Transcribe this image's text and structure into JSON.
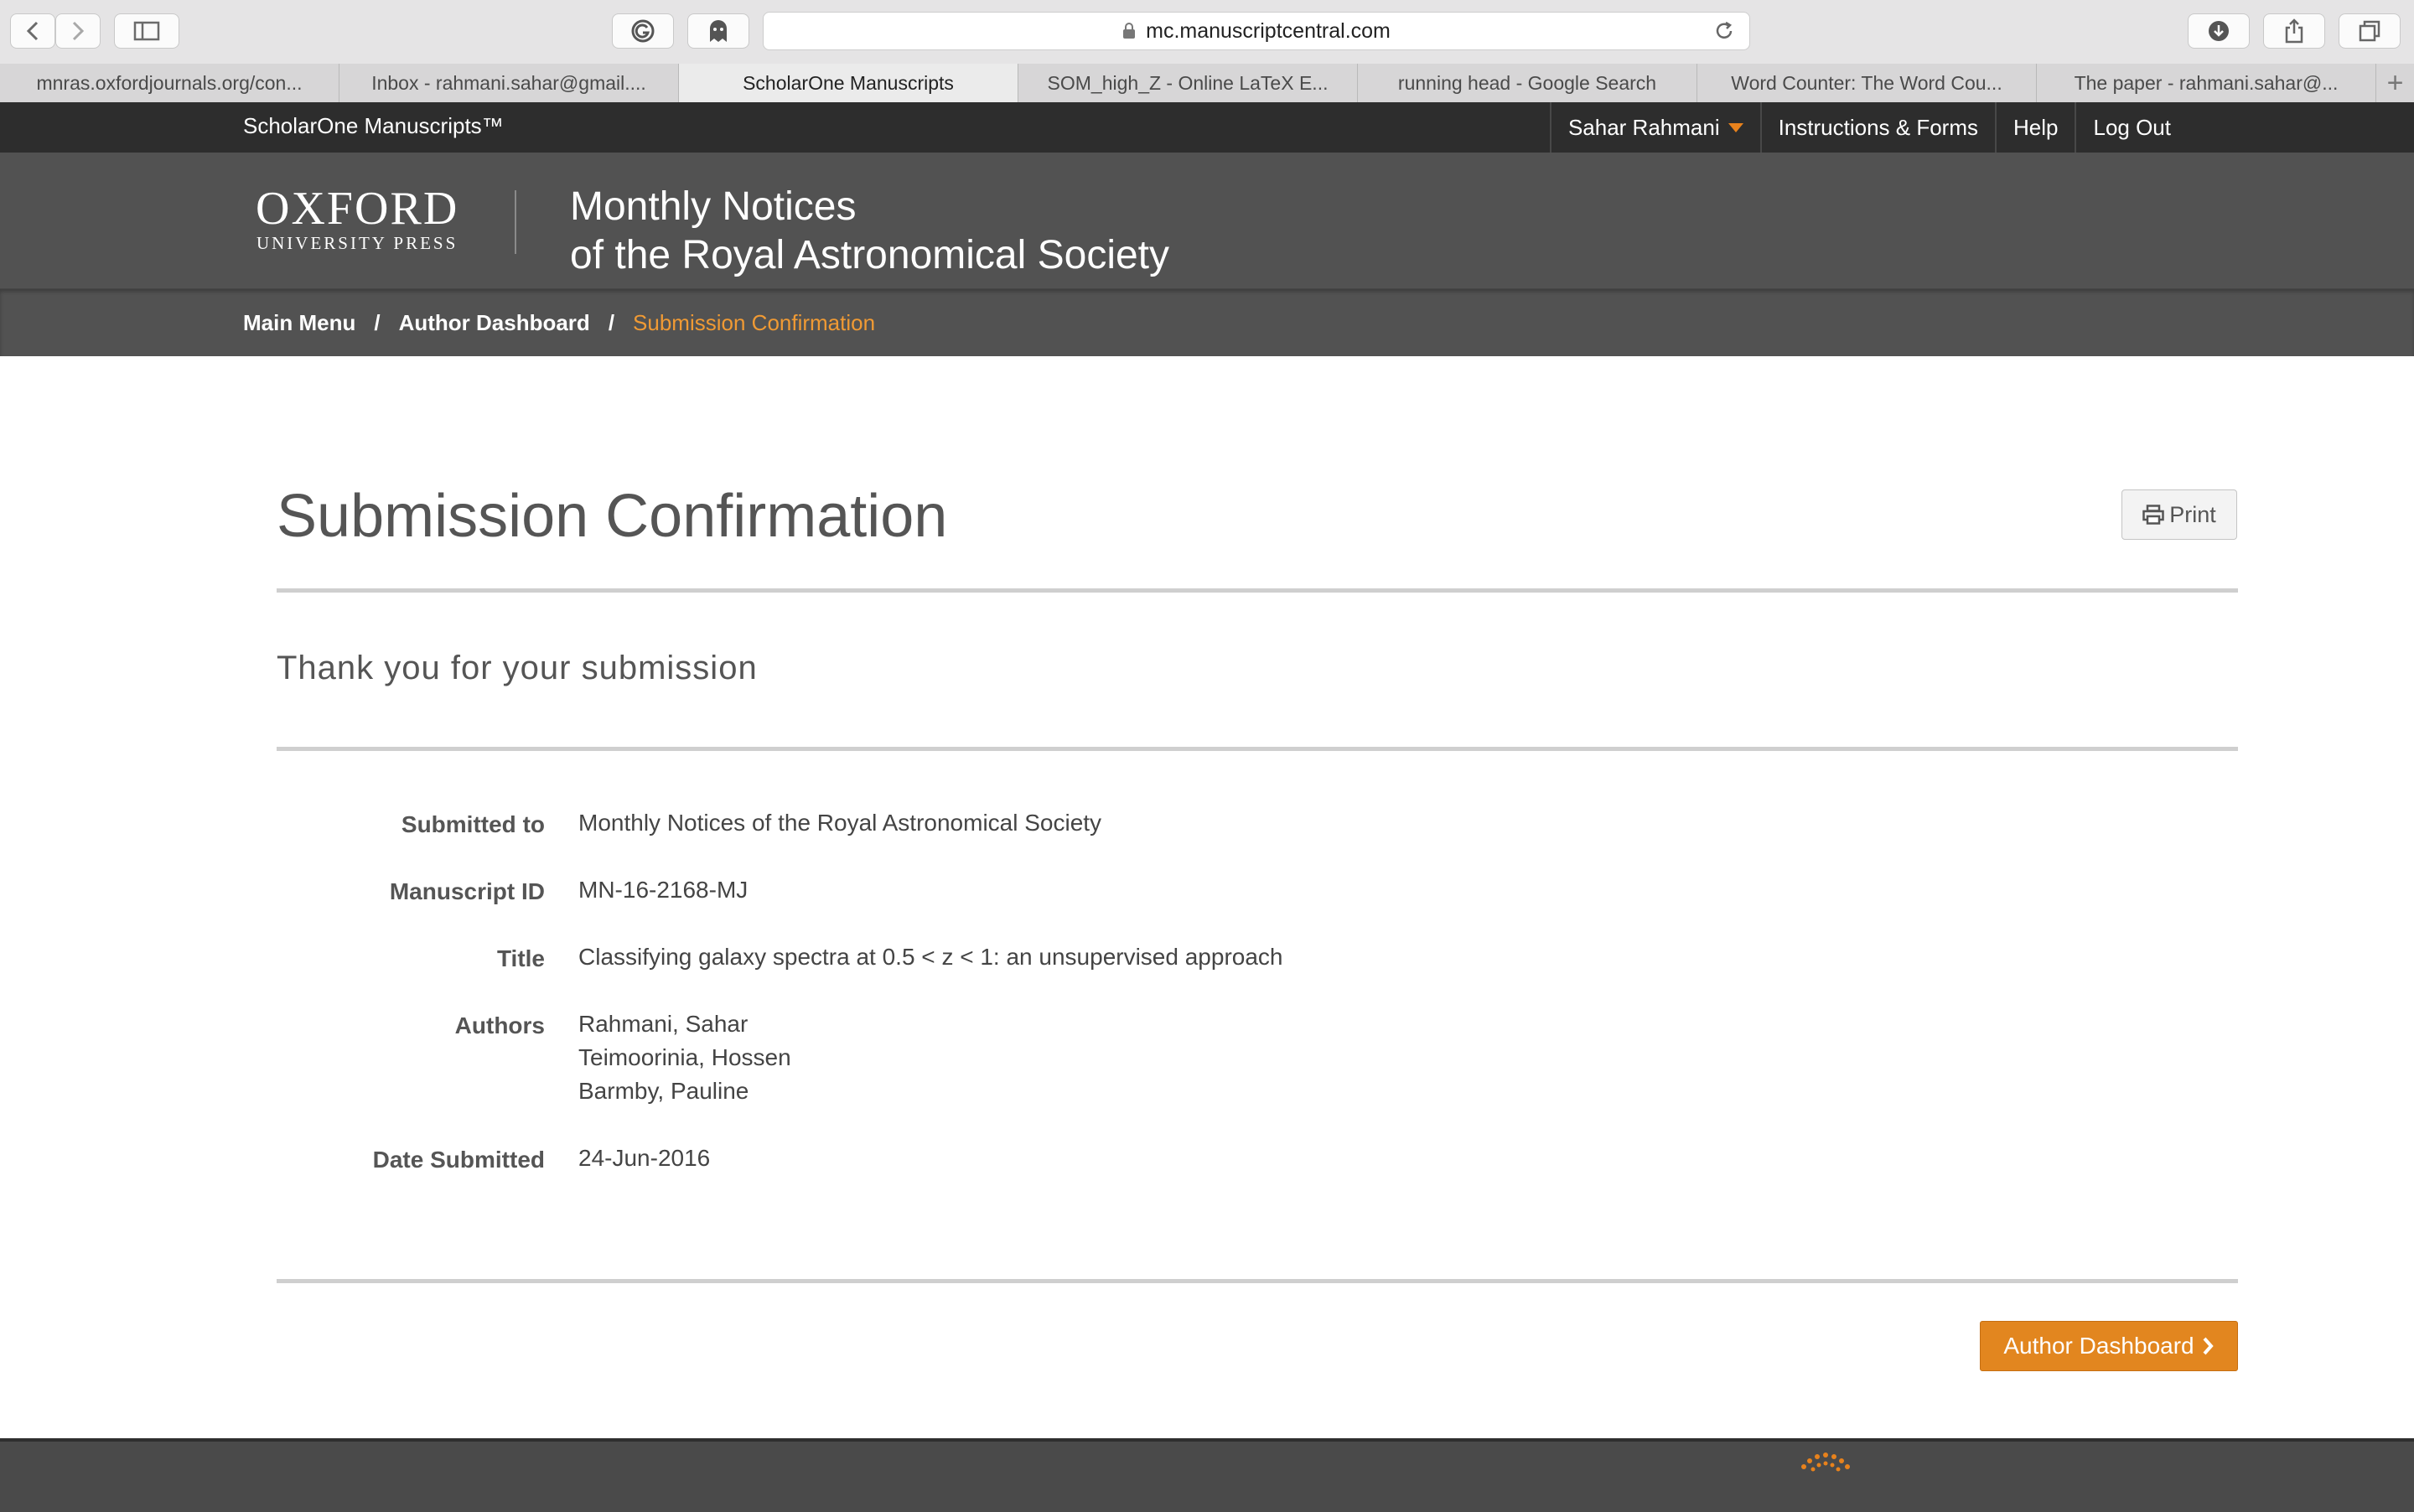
{
  "browser": {
    "url": "mc.manuscriptcentral.com",
    "tabs": [
      {
        "label": "mnras.oxfordjournals.org/con..."
      },
      {
        "label": "Inbox - rahmani.sahar@gmail...."
      },
      {
        "label": "ScholarOne Manuscripts"
      },
      {
        "label": "SOM_high_Z - Online LaTeX E..."
      },
      {
        "label": "running head - Google Search"
      },
      {
        "label": "Word Counter: The Word Cou..."
      },
      {
        "label": "The paper - rahmani.sahar@..."
      }
    ],
    "new_tab_label": "+"
  },
  "header": {
    "brand": "ScholarOne Manuscripts™",
    "user_name": "Sahar Rahmani",
    "instructions_label": "Instructions & Forms",
    "help_label": "Help",
    "logout_label": "Log Out",
    "publisher_line1": "OXFORD",
    "publisher_line2": "UNIVERSITY PRESS",
    "journal_line1": "Monthly Notices",
    "journal_line2": "of the Royal Astronomical Society"
  },
  "breadcrumb": {
    "main_menu": "Main Menu",
    "separator": "/",
    "author_dashboard": "Author Dashboard",
    "current": "Submission Confirmation"
  },
  "main": {
    "title": "Submission Confirmation",
    "print_label": "Print",
    "thanks": "Thank you for your submission",
    "fields": {
      "submitted_to_label": "Submitted to",
      "submitted_to": "Monthly Notices of the Royal Astronomical Society",
      "manuscript_id_label": "Manuscript ID",
      "manuscript_id": "MN-16-2168-MJ",
      "title_label": "Title",
      "title": "Classifying galaxy spectra at 0.5 < z < 1: an unsupervised approach",
      "authors_label": "Authors",
      "authors": [
        "Rahmani, Sahar",
        "Teimoorinia, Hossen",
        "Barmby, Pauline"
      ],
      "date_label": "Date Submitted",
      "date": "24-Jun-2016"
    },
    "dashboard_button": "Author Dashboard"
  },
  "colors": {
    "accent_orange": "#e2861f",
    "breadcrumb_current": "#f09a34",
    "topnav_bg": "#2d2d2d",
    "banner_bg": "#525252"
  }
}
